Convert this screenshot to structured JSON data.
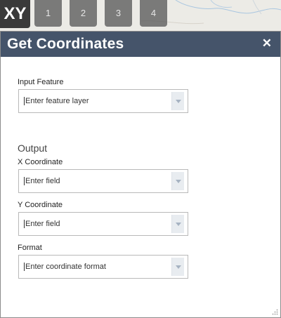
{
  "map": {
    "xy_label": "XY",
    "page_tabs": [
      "1",
      "2",
      "3",
      "4"
    ]
  },
  "panel": {
    "title": "Get Coordinates",
    "close_glyph": "✕"
  },
  "form": {
    "input_feature": {
      "label": "Input Feature",
      "placeholder": "Enter feature layer"
    },
    "output_section": "Output",
    "x_coordinate": {
      "label": "X Coordinate",
      "placeholder": "Enter field"
    },
    "y_coordinate": {
      "label": "Y Coordinate",
      "placeholder": "Enter field"
    },
    "format": {
      "label": "Format",
      "placeholder": "Enter coordinate format"
    }
  },
  "colors": {
    "header_bg": "#45546a",
    "map_bg": "#ecebe6",
    "xy_tile": "#3a3a3a"
  },
  "icons": {
    "close": "close-icon",
    "dropdown": "chevron-down-icon",
    "resize": "resize-grip-icon"
  }
}
